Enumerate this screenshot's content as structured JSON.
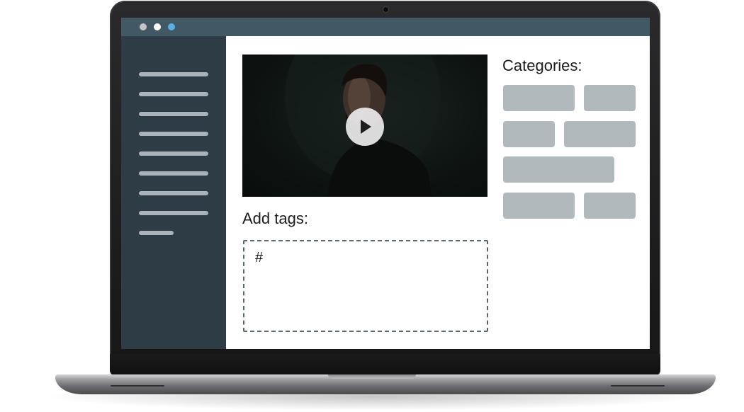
{
  "window": {
    "controls": [
      {
        "name": "close",
        "color": "#c4c4c4"
      },
      {
        "name": "minimize",
        "color": "#ffffff"
      },
      {
        "name": "maximize",
        "color": "#5aaee6"
      }
    ]
  },
  "sidebar": {
    "placeholder_items": 9
  },
  "video": {
    "icon": "play-icon"
  },
  "tags": {
    "heading": "Add tags:",
    "prefix": "#"
  },
  "categories": {
    "heading": "Categories:",
    "chip_count": 7
  }
}
